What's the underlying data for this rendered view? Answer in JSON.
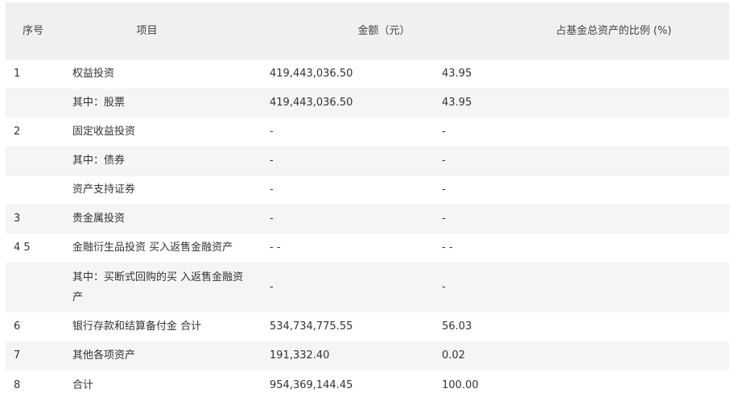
{
  "header": {
    "col_no": "序号",
    "col_item": "项目",
    "col_amount": "金额（元）",
    "col_ratio": "占基金总资产的比例 (%)"
  },
  "rows": [
    {
      "no": "1",
      "item": "权益投资",
      "amount": "419,443,036.50",
      "ratio": "43.95"
    },
    {
      "no": "",
      "item": "其中：股票",
      "amount": "419,443,036.50",
      "ratio": "43.95"
    },
    {
      "no": "2",
      "item": "固定收益投资",
      "amount": "-",
      "ratio": "-"
    },
    {
      "no": "",
      "item": "其中：债券",
      "amount": "-",
      "ratio": "-"
    },
    {
      "no": "",
      "item": "资产支持证券",
      "amount": "-",
      "ratio": "-"
    },
    {
      "no": "3",
      "item": "贵金属投资",
      "amount": "-",
      "ratio": "-"
    },
    {
      "no": "4 5",
      "item": "金融衍生品投资 买入返售金融资产",
      "amount": "- -",
      "ratio": "- -"
    },
    {
      "no": "",
      "item": "其中：买断式回购的买 入返售金融资产",
      "amount": "-",
      "ratio": "-"
    },
    {
      "no": "6",
      "item": "银行存款和结算备付金 合计",
      "amount": "534,734,775.55",
      "ratio": "56.03"
    },
    {
      "no": "7",
      "item": "其他各项资产",
      "amount": "191,332.40",
      "ratio": "0.02"
    },
    {
      "no": "8",
      "item": "合计",
      "amount": "954,369,144.45",
      "ratio": "100.00"
    }
  ]
}
